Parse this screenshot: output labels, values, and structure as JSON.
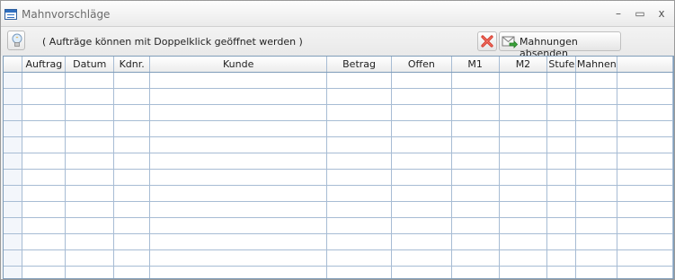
{
  "window": {
    "title": "Mahnvorschläge",
    "minimize": "–",
    "maximize": "▭",
    "close": "x"
  },
  "toolbar": {
    "hint": "( Aufträge können mit Doppelklick geöffnet werden )",
    "send_label": "Mahnungen absenden"
  },
  "table": {
    "columns": [
      "Auftrag",
      "Datum",
      "Kdnr.",
      "Kunde",
      "Betrag",
      "Offen",
      "M1",
      "M2",
      "Stufe",
      "Mahnen"
    ],
    "rows": []
  },
  "colors": {
    "accent": "#2f6fbf",
    "grid_line": "#a7bcd4",
    "delete_red": "#d83a2c"
  },
  "icons": {
    "title": "table-icon",
    "info": "lightbulb-icon",
    "delete": "red-x-icon",
    "send": "mail-send-icon"
  }
}
